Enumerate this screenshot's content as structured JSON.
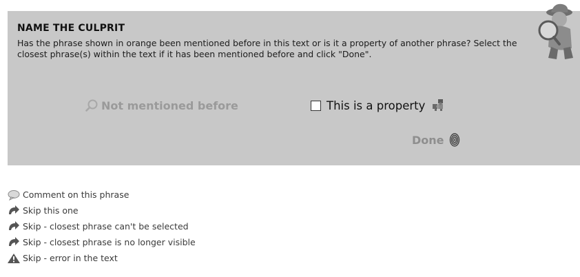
{
  "panel": {
    "title": "NAME THE CULPRIT",
    "description": "Has the phrase shown in orange been mentioned before in this text or is it a property of another phrase? Select the closest phrase(s) within the text if it has been mentioned before and click \"Done\".",
    "not_mentioned_label": "Not mentioned before",
    "property_label": "This is a property",
    "property_checked": false,
    "done_label": "Done"
  },
  "links": [
    {
      "label": "Comment on this phrase",
      "icon": "speech-bubble-icon"
    },
    {
      "label": "Skip this one",
      "icon": "skip-arrow-icon"
    },
    {
      "label": "Skip - closest phrase can't be selected",
      "icon": "skip-arrow-icon"
    },
    {
      "label": "Skip - closest phrase is no longer visible",
      "icon": "skip-arrow-icon"
    },
    {
      "label": "Skip - error in the text",
      "icon": "warning-icon"
    }
  ],
  "colors": {
    "panel_bg": "#c8c8c8",
    "disabled_text": "#9a9a9a",
    "link_text": "#3a3a3a"
  }
}
